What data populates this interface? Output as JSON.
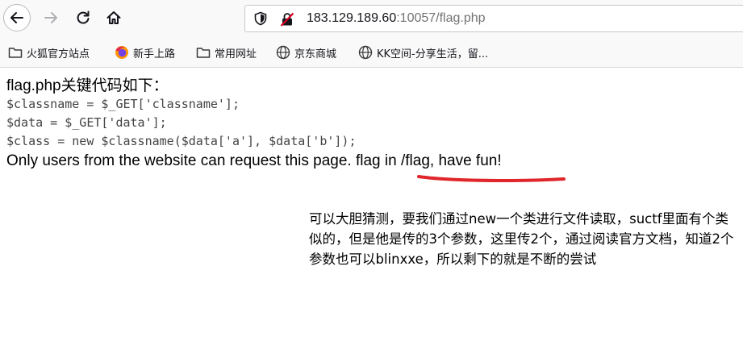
{
  "browser": {
    "url_host": "183.129.189.60",
    "url_rest": ":10057/flag.php"
  },
  "bookmarks": [
    {
      "label": "火狐官方站点",
      "icon": "folder-icon"
    },
    {
      "label": "新手上路",
      "icon": "firefox-icon"
    },
    {
      "label": "常用网址",
      "icon": "folder-icon"
    },
    {
      "label": "京东商城",
      "icon": "globe-icon"
    },
    {
      "label": "KK空间-分享生活，留...",
      "icon": "globe-icon"
    }
  ],
  "page": {
    "heading": "flag.php关键代码如下：",
    "code_lines": [
      "$classname = $_GET['classname'];",
      "$data = $_GET['data'];",
      "$class = new $classname($data['a'], $data['b']);"
    ],
    "message": "Only users from the website can request this page. flag in /flag, have fun!",
    "underline_color": "#e0262b"
  },
  "annotation": {
    "text": "可以大胆猜测，要我们通过new一个类进行文件读取，suctf里面有个类似的，但是他是传的3个参数，这里传2个，通过阅读官方文档，知道2个参数也可以blinxxe，所以剩下的就是不断的尝试"
  }
}
